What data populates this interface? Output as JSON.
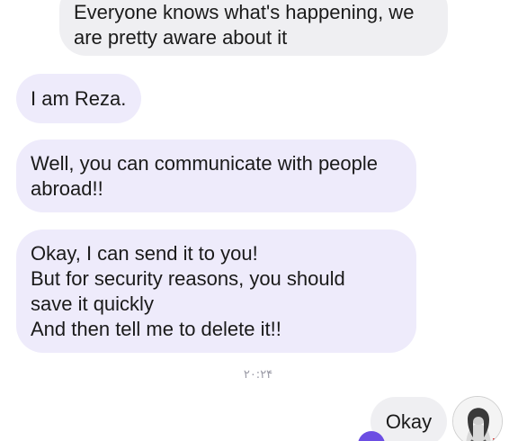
{
  "messages": [
    {
      "lines": [
        "Everyone knows what's happening, we",
        "are pretty aware about it"
      ]
    },
    {
      "lines": [
        "I am Reza."
      ]
    },
    {
      "lines": [
        "Well, you can communicate with people",
        "abroad!!"
      ]
    },
    {
      "lines": [
        "Okay, I can send it to you!",
        "But for security reasons, you should",
        "save it quickly",
        "And then tell me to delete it!!"
      ]
    },
    {
      "lines": [
        "Okay"
      ]
    }
  ],
  "timestamp": "۲۰:۲۴",
  "icons": {
    "avatar": "avatar-icon",
    "reaction": "reaction-icon"
  },
  "colors": {
    "incoming_gray_bubble": "#efeff2",
    "incoming_lilac_bubble": "#eeebfb",
    "accent": "#6c4ee3",
    "timestamp": "#9a9aa6"
  }
}
